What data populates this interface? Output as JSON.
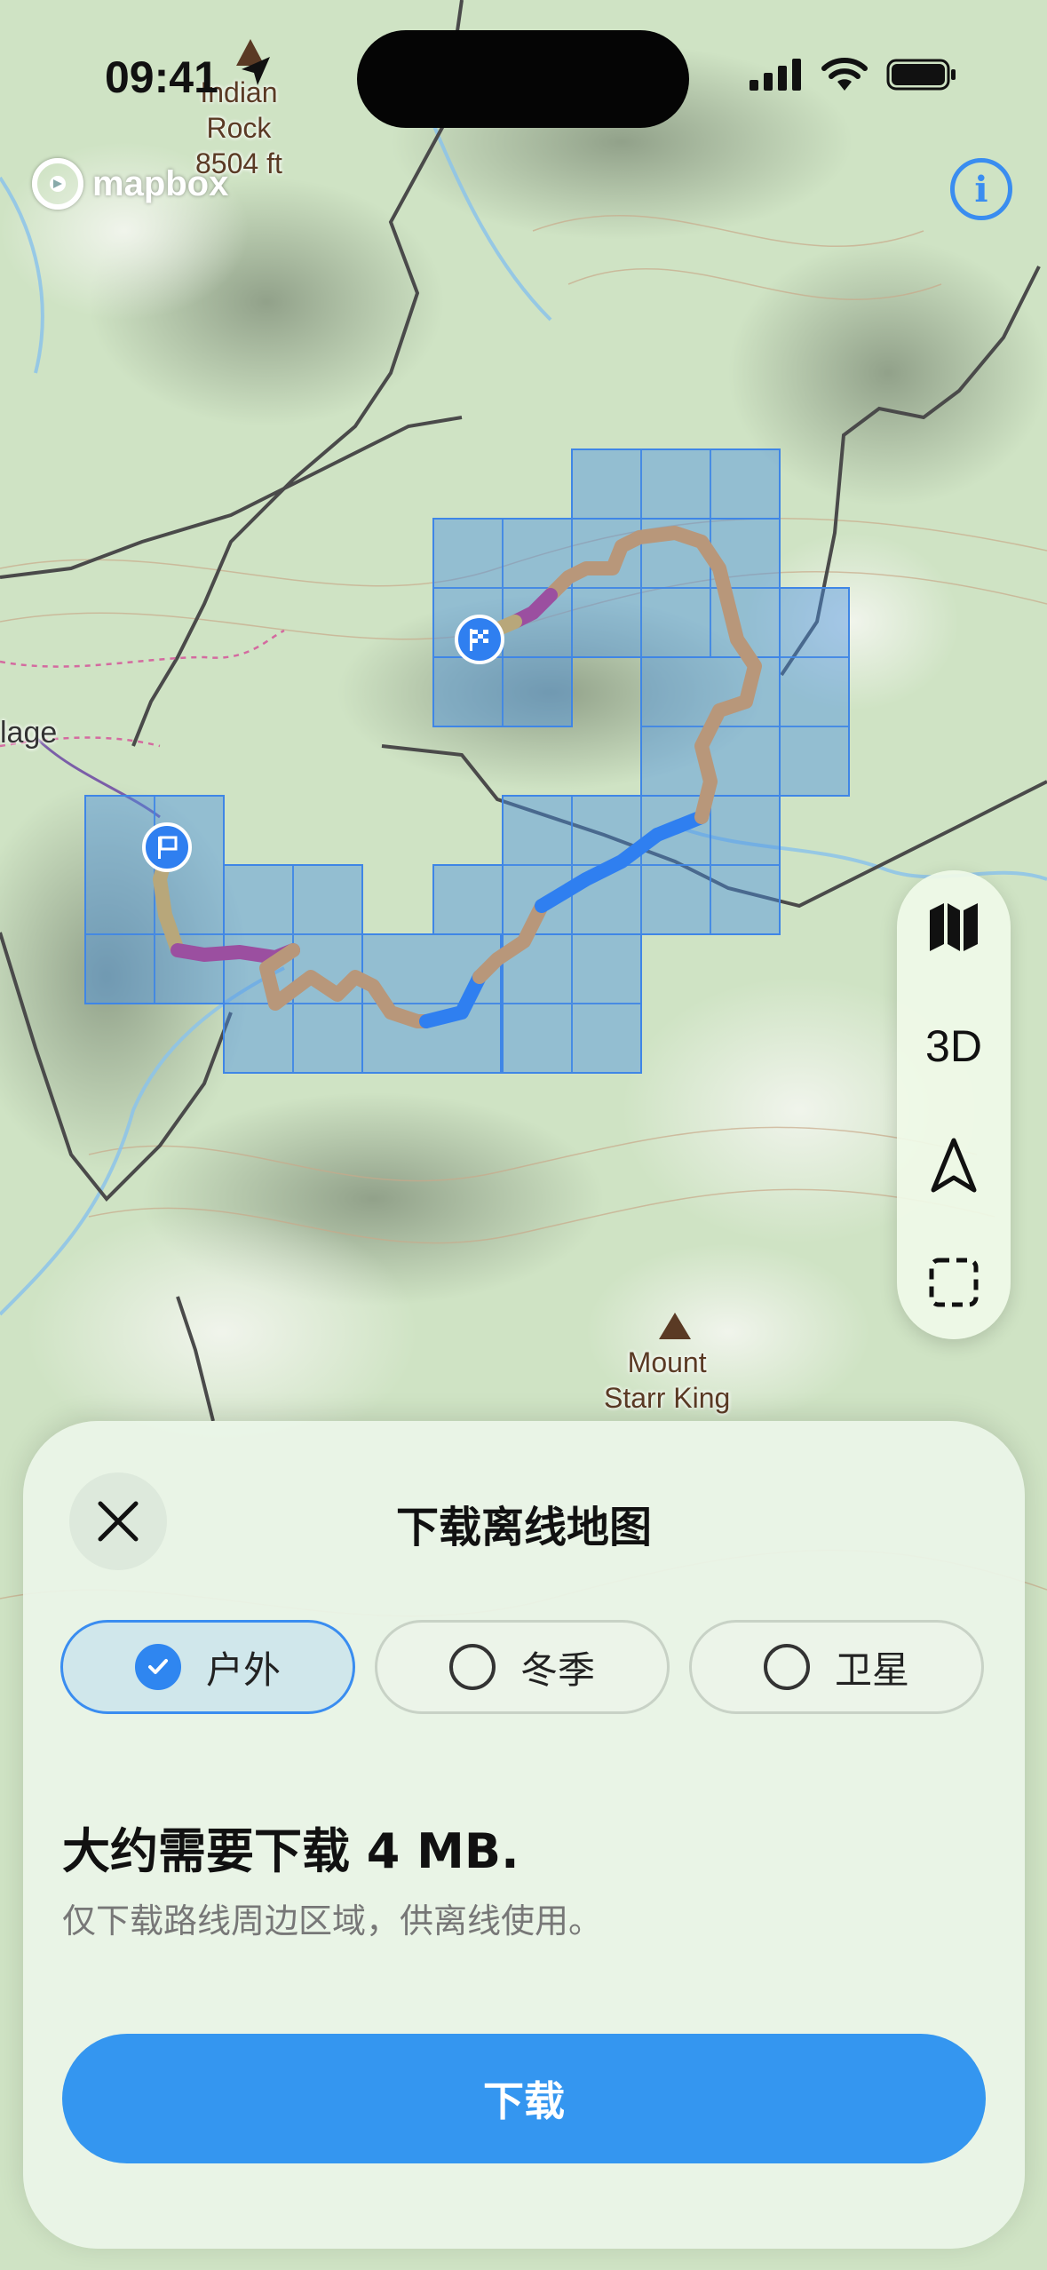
{
  "status_bar": {
    "time": "09:41"
  },
  "map": {
    "attribution": "mapbox",
    "labels": {
      "indian_rock": [
        "Indian",
        "Rock",
        "8504 ft"
      ],
      "mount_starr_king": [
        "Mount",
        "Starr King"
      ],
      "village": "lage"
    }
  },
  "map_controls": {
    "three_d_label": "3D",
    "icons": [
      "map-icon",
      "3d-toggle",
      "navigation-arrow-icon",
      "select-area-icon"
    ]
  },
  "sheet": {
    "title": "下载离线地图",
    "styles": [
      {
        "label": "户外",
        "selected": true
      },
      {
        "label": "冬季",
        "selected": false
      },
      {
        "label": "卫星",
        "selected": false
      }
    ],
    "size_text": "大约需要下载 4 MB.",
    "description": "仅下载路线周边区域，供离线使用。",
    "download_label": "下载"
  },
  "colors": {
    "accent": "#3496f0",
    "tile_fill": "#4a90e2",
    "route_tan": "#b8977a",
    "route_purple": "#9b4fa0",
    "route_blue": "#2f7ff0"
  }
}
